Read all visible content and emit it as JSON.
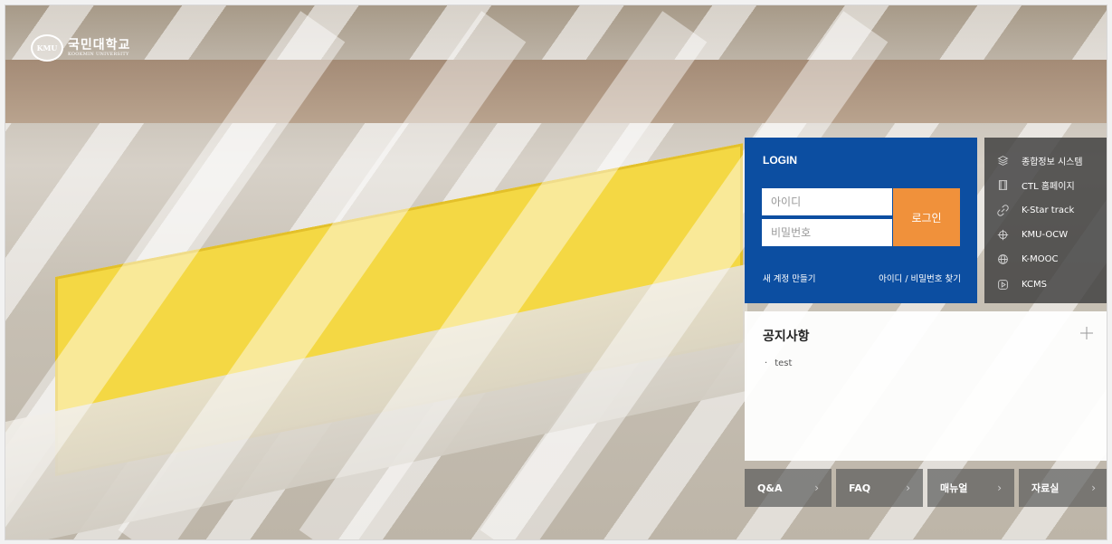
{
  "logo": {
    "mark": "KMU",
    "name_ko": "국민대학교",
    "name_en": "KOOKMIN UNIVERSITY"
  },
  "login": {
    "title": "LOGIN",
    "id_placeholder": "아이디",
    "pw_placeholder": "비밀번호",
    "submit_label": "로그인",
    "new_account": "새 계정 만들기",
    "find_account": "아이디 / 비밀번호 찾기"
  },
  "quick_links": [
    {
      "label": "종합정보 시스템",
      "icon": "layers-icon"
    },
    {
      "label": "CTL 홈페이지",
      "icon": "film-icon"
    },
    {
      "label": "K-Star track",
      "icon": "link-icon"
    },
    {
      "label": "KMU-OCW",
      "icon": "crosshair-icon"
    },
    {
      "label": "K-MOOC",
      "icon": "globe-icon"
    },
    {
      "label": "KCMS",
      "icon": "play-icon"
    }
  ],
  "notice": {
    "title": "공지사항",
    "items": [
      "test"
    ]
  },
  "bottom_nav": [
    {
      "label": "Q&A"
    },
    {
      "label": "FAQ"
    },
    {
      "label": "매뉴얼"
    },
    {
      "label": "자료실"
    }
  ],
  "colors": {
    "login_bg": "#0c4ea1",
    "login_button": "#f0913b",
    "quick_bg": "#3c3c3c"
  }
}
